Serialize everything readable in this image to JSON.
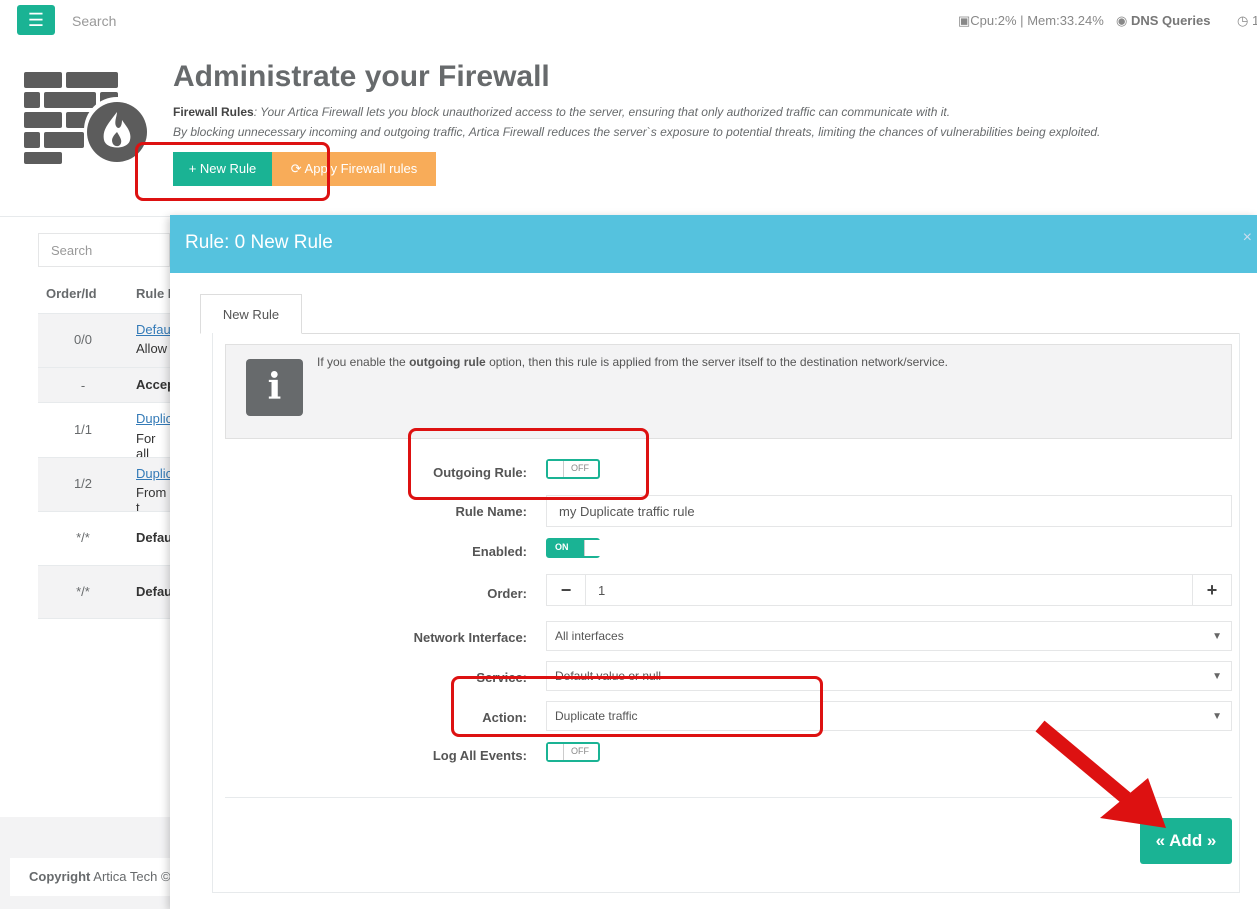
{
  "topbar": {
    "menu_icon": "hamburger-icon",
    "search_placeholder": "Search",
    "cpu": "Cpu:2%",
    "separator": "|",
    "mem": "Mem:33.24%",
    "dns": "DNS Queries",
    "clock_text": "1"
  },
  "header": {
    "title": "Administrate your Firewall",
    "desc_label": "Firewall Rules",
    "desc_line1": ": Your Artica Firewall lets you block unauthorized access to the server, ensuring that only authorized traffic can communicate with it.",
    "desc_line2": "By blocking unnecessary incoming and outgoing traffic, Artica Firewall reduces the server`s exposure to potential threats, limiting the chances of vulnerabilities being exploited.",
    "new_rule_label": "New Rule",
    "apply_label": "Apply Firewall rules"
  },
  "list": {
    "search_placeholder": "Search",
    "col_order": "Order/Id",
    "col_rule": "Rule N",
    "rows": [
      {
        "id": "0/0",
        "name": "Defau",
        "sub": "Allow"
      },
      {
        "id": "-",
        "name": "",
        "sub": "Accep"
      },
      {
        "id": "1/1",
        "name": "Duplic",
        "sub": "For all"
      },
      {
        "id": "1/2",
        "name": "Duplic",
        "sub": "From t"
      },
      {
        "id": "*/*",
        "name": "",
        "sub": "Defau"
      },
      {
        "id": "*/*",
        "name": "",
        "sub": "Defau"
      }
    ]
  },
  "footer": {
    "copyright_bold": "Copyright",
    "copyright_rest": " Artica Tech ©"
  },
  "modal": {
    "title": "Rule: 0 New Rule",
    "close": "×",
    "tab_label": "New Rule",
    "info_prefix": "If you enable the ",
    "info_bold": "outgoing rule",
    "info_suffix": " option, then this rule is applied from the server itself to the destination network/service.",
    "outgoing_label": "Outgoing Rule:",
    "outgoing_state": "OFF",
    "rule_name_label": "Rule Name:",
    "rule_name_value": "my Duplicate traffic rule",
    "enabled_label": "Enabled:",
    "enabled_state": "ON",
    "order_label": "Order:",
    "order_value": "1",
    "order_minus": "−",
    "order_plus": "+",
    "interface_label": "Network Interface:",
    "interface_value": "All interfaces",
    "service_label": "Service:",
    "service_value": "Default value or null",
    "action_label": "Action:",
    "action_value": "Duplicate traffic",
    "log_label": "Log All Events:",
    "log_state": "OFF",
    "add_label": "« Add »"
  },
  "colors": {
    "primary": "#1ab394",
    "warning": "#f8ac59",
    "modal_header": "#55c2de",
    "annotation": "#dd1111"
  }
}
